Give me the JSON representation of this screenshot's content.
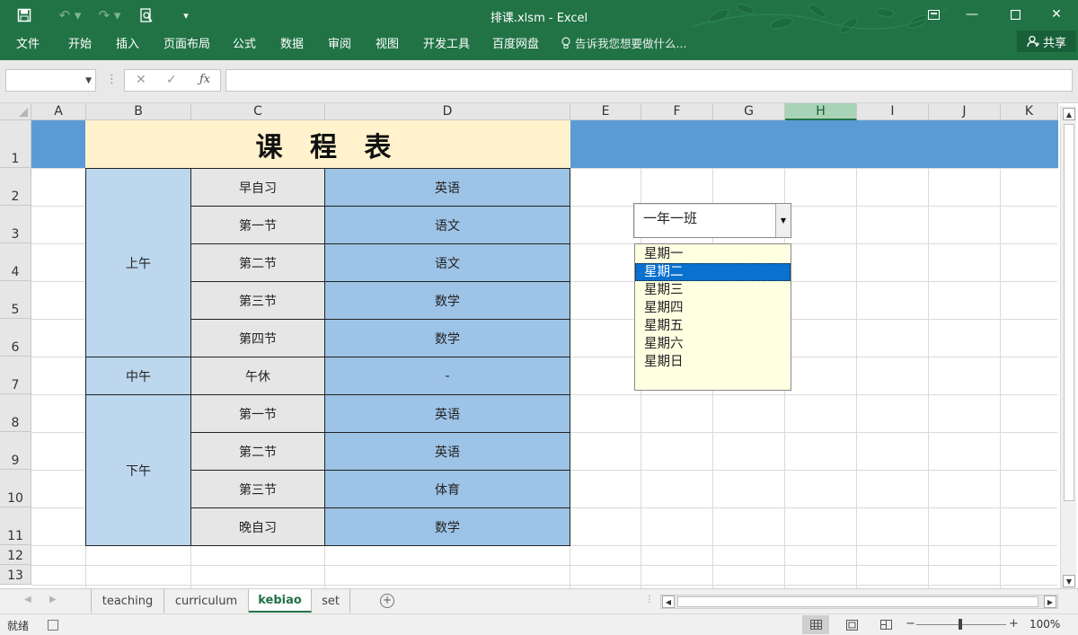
{
  "window": {
    "title": "排课.xlsm - Excel"
  },
  "ribbon": {
    "tabs": [
      "文件",
      "开始",
      "插入",
      "页面布局",
      "公式",
      "数据",
      "审阅",
      "视图",
      "开发工具",
      "百度网盘"
    ],
    "tell_me": "告诉我您想要做什么...",
    "share": "共享"
  },
  "formula_bar": {
    "name_box": "",
    "formula": ""
  },
  "sheet": {
    "columns": [
      "A",
      "B",
      "C",
      "D",
      "E",
      "F",
      "G",
      "H",
      "I",
      "J",
      "K"
    ],
    "selected_column": "H",
    "rows": [
      "1",
      "2",
      "3",
      "4",
      "5",
      "6",
      "7",
      "8",
      "9",
      "10",
      "11",
      "12",
      "13"
    ],
    "schedule": {
      "title": "课 程 表",
      "morning": "上午",
      "noon": "中午",
      "afternoon": "下午",
      "periods": [
        "早自习",
        "第一节",
        "第二节",
        "第三节",
        "第四节",
        "午休",
        "第一节",
        "第二节",
        "第三节",
        "晚自习"
      ],
      "subjects": [
        "英语",
        "语文",
        "语文",
        "数学",
        "数学",
        "-",
        "英语",
        "英语",
        "体育",
        "数学"
      ]
    }
  },
  "controls": {
    "class_combo": {
      "value": "一年一班"
    },
    "day_list": {
      "items": [
        "星期一",
        "星期二",
        "星期三",
        "星期四",
        "星期五",
        "星期六",
        "星期日"
      ],
      "selected_index": 1
    }
  },
  "sheet_tabs": {
    "tabs": [
      "teaching",
      "curriculum",
      "kebiao",
      "set"
    ],
    "active": "kebiao"
  },
  "status_bar": {
    "ready": "就绪",
    "zoom": "100%"
  }
}
